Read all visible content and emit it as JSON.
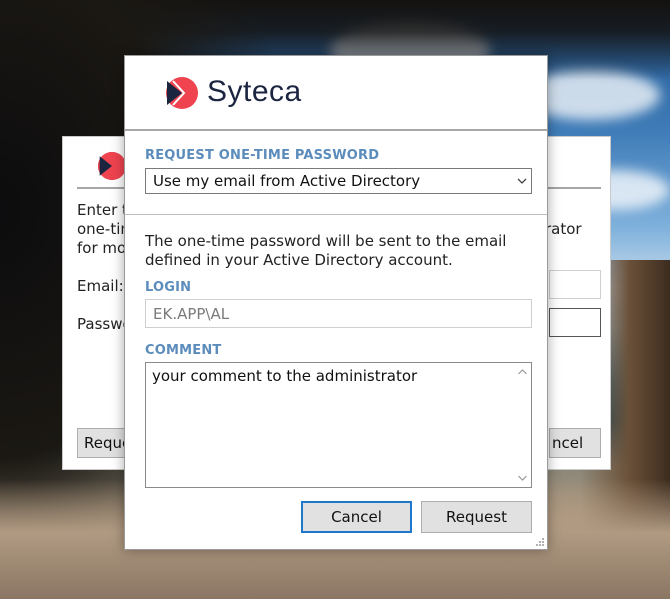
{
  "background_window": {
    "intro_text_lines": [
      "Enter t",
      "one-tim",
      "for mo"
    ],
    "intro_text_right": "rator",
    "email_label": "Email:",
    "password_label": "Passwo",
    "request_button_label": "Reque",
    "cancel_button_label": "ncel"
  },
  "dialog": {
    "logo_text": "Syteca",
    "request_section": {
      "label": "REQUEST ONE-TIME PASSWORD",
      "selected_option": "Use my email from Active Directory"
    },
    "info_text": "The one-time password will be sent to the email defined in your Active Directory account.",
    "login": {
      "label": "LOGIN",
      "value": "EK.APP\\AL"
    },
    "comment": {
      "label": "COMMENT",
      "value": "your comment to the administrator"
    },
    "buttons": {
      "cancel_label": "Cancel",
      "request_label": "Request"
    }
  },
  "colors": {
    "accent_label": "#5b8cbc",
    "logo_red": "#ef4350",
    "logo_navy": "#1c2540",
    "focus_border": "#1f77cc"
  },
  "icons": {
    "logo": "syteca-logo-icon",
    "dropdown": "chevron-down-icon",
    "scroll_up": "scroll-up-arrow-icon",
    "scroll_down": "scroll-down-arrow-icon",
    "resize": "resize-grip-icon"
  }
}
